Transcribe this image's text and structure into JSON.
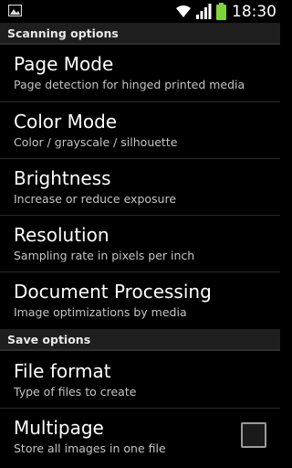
{
  "status_bar": {
    "time": "18:30",
    "left_icon": "image-icon",
    "right_icons": [
      "wifi-icon",
      "signal-icon",
      "battery-icon"
    ],
    "battery_color": "#7fd43b"
  },
  "sections": {
    "scanning": {
      "header": "Scanning options"
    },
    "save": {
      "header": "Save options"
    }
  },
  "scanning_items": [
    {
      "title": "Page Mode",
      "summary": "Page detection for hinged printed media"
    },
    {
      "title": "Color Mode",
      "summary": "Color / grayscale / silhouette"
    },
    {
      "title": "Brightness",
      "summary": "Increase or reduce exposure"
    },
    {
      "title": "Resolution",
      "summary": "Sampling rate in pixels per inch"
    },
    {
      "title": "Document Processing",
      "summary": "Image optimizations by media"
    }
  ],
  "save_items": [
    {
      "title": "File format",
      "summary": "Type of files to create"
    },
    {
      "title": "Multipage",
      "summary": "Store all images in one file",
      "checked": false
    }
  ]
}
